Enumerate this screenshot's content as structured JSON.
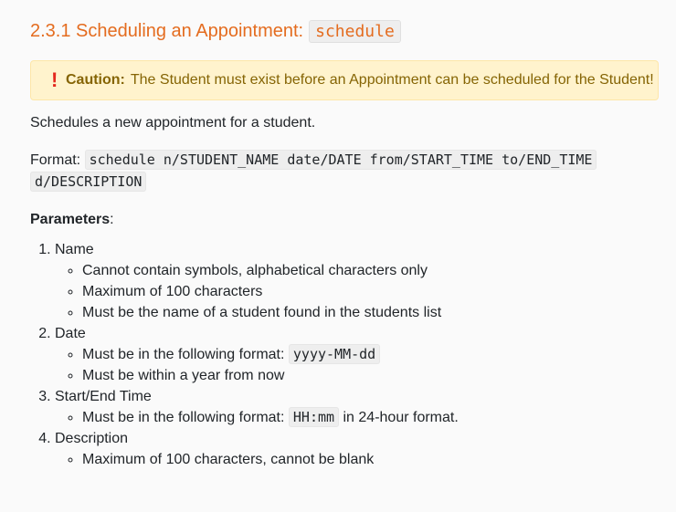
{
  "heading": {
    "text": "2.3.1 Scheduling an Appointment:",
    "command": "schedule"
  },
  "caution": {
    "icon": "exclamation-icon",
    "label": "Caution:",
    "text": "The Student must exist before an Appointment can be scheduled for the Student!"
  },
  "description": "Schedules a new appointment for a student.",
  "format": {
    "label": "Format:",
    "line1": "schedule n/STUDENT_NAME date/DATE from/START_TIME to/END_TIME",
    "line2": "d/DESCRIPTION"
  },
  "parameters_label": "Parameters",
  "parameters_colon": ":",
  "parameters": [
    {
      "name": "Name",
      "rules": [
        "Cannot contain symbols, alphabetical characters only",
        "Maximum of 100 characters",
        "Must be the name of a student found in the students list"
      ]
    },
    {
      "name": "Date",
      "rules_a": "Must be in the following format:",
      "code": "yyyy-MM-dd",
      "rule2": "Must be within a year from now"
    },
    {
      "name": "Start/End Time",
      "rules_a": "Must be in the following format:",
      "code": "HH:mm",
      "rules_b": "in 24-hour format."
    },
    {
      "name": "Description",
      "rule1": "Maximum of 100 characters, cannot be blank"
    }
  ],
  "colors": {
    "heading": "#e46c1f",
    "caution_bg": "#fff3cd",
    "caution_text": "#856404",
    "caution_mark": "#e4281e"
  }
}
